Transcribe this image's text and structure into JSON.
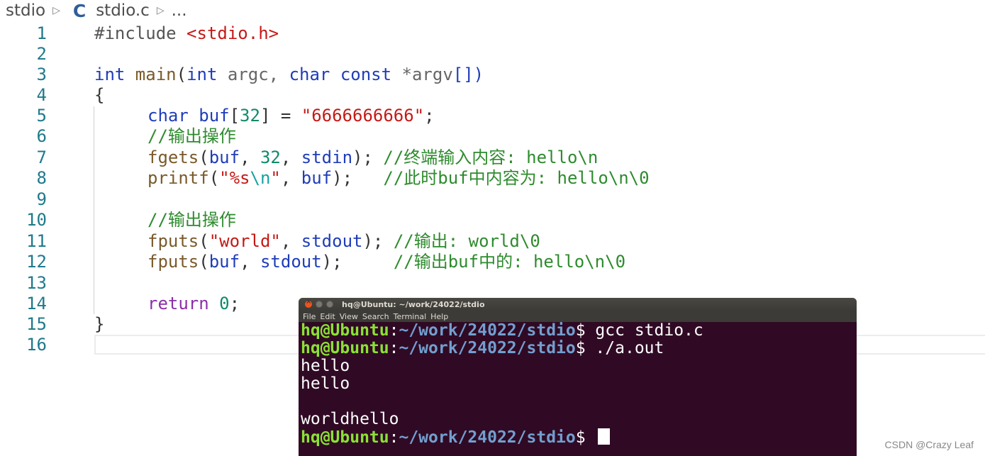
{
  "breadcrumb": {
    "folder": "stdio",
    "lang_icon": "C",
    "file": "stdio.c",
    "more": "..."
  },
  "code": {
    "line_numbers": [
      "1",
      "2",
      "3",
      "4",
      "5",
      "6",
      "7",
      "8",
      "9",
      "10",
      "11",
      "12",
      "13",
      "14",
      "15",
      "16"
    ],
    "l1": {
      "pp": "#include ",
      "hdr": "<stdio.h>"
    },
    "l3": {
      "int1": "int",
      "main": " main",
      "p1": "(",
      "int2": "int",
      "argc": " argc, ",
      "char": "char",
      "sp": " ",
      "const": "const",
      "argv": " *argv",
      "br": "[])"
    },
    "l4": {
      "brace": "{"
    },
    "l5": {
      "char": "char",
      "buf": " buf",
      "b1": "[",
      "n32": "32",
      "b2": "] = ",
      "str": "\"6666666666\"",
      "semi": ";"
    },
    "l6": {
      "cmt": "//输出操作"
    },
    "l7": {
      "fn": "fgets",
      "p": "(",
      "buf": "buf",
      "c1": ", ",
      "n": "32",
      "c2": ", ",
      "stdin": "stdin",
      "end": "); ",
      "cmt": "//终端输入内容: hello\\n"
    },
    "l8": {
      "fn": "printf",
      "p": "(",
      "s1": "\"%s",
      "esc": "\\n",
      "s2": "\"",
      "c": ", ",
      "buf": "buf",
      "end": ");   ",
      "cmt": "//此时buf中内容为: hello\\n\\0"
    },
    "l10": {
      "cmt": "//输出操作"
    },
    "l11": {
      "fn": "fputs",
      "p": "(",
      "str": "\"world\"",
      "c": ", ",
      "stdout": "stdout",
      "end": "); ",
      "cmt": "//输出: world\\0"
    },
    "l12": {
      "fn": "fputs",
      "p": "(",
      "buf": "buf",
      "c": ", ",
      "stdout": "stdout",
      "end": ");     ",
      "cmt": "//输出buf中的: hello\\n\\0"
    },
    "l14": {
      "ret": "return",
      "sp": " ",
      "zero": "0",
      "semi": ";"
    },
    "l15": {
      "brace": "}"
    }
  },
  "terminal": {
    "title": "hq@Ubuntu: ~/work/24022/stdio",
    "menu": [
      "File",
      "Edit",
      "View",
      "Search",
      "Terminal",
      "Help"
    ],
    "prompt_user": "hq@Ubuntu",
    "prompt_colon": ":",
    "prompt_path": "~/work/24022/stdio",
    "cmd1": "$ gcc stdio.c",
    "cmd2": "$ ./a.out",
    "out1": "hello",
    "out2": "hello",
    "out3": "",
    "out4": "worldhello",
    "cmd3": "$ "
  },
  "watermark": "CSDN @Crazy Leaf"
}
